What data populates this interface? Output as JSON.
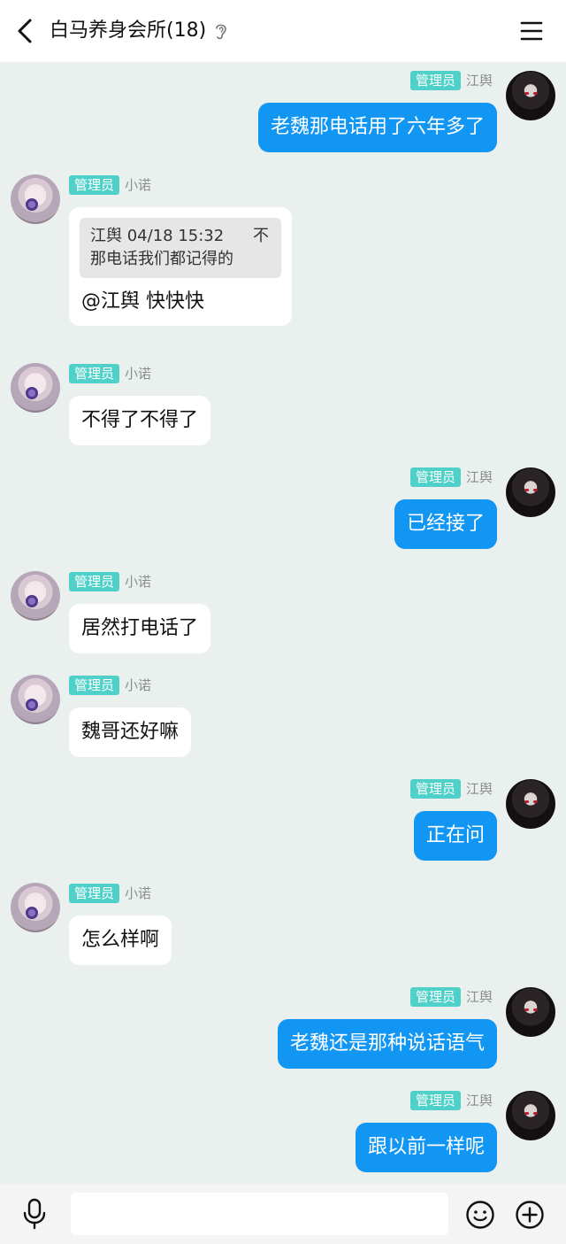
{
  "header": {
    "title": "白马养身会所(18)",
    "back_icon": "chevron-left-icon",
    "ear_icon": "ear-icon",
    "menu_icon": "hamburger-menu-icon"
  },
  "messages": [
    {
      "side": "right",
      "badge": "管理员",
      "nick": "江舆",
      "text": "老魏那电话用了六年多了"
    },
    {
      "side": "left",
      "badge": "管理员",
      "nick": "小诺",
      "quote": {
        "header": "江舆 04/18 15:32",
        "close": "不",
        "text": "那电话我们都记得的"
      },
      "text": "@江舆 快快快"
    },
    {
      "side": "left",
      "badge": "管理员",
      "nick": "小诺",
      "text": "不得了不得了"
    },
    {
      "side": "right",
      "badge": "管理员",
      "nick": "江舆",
      "text": "已经接了"
    },
    {
      "side": "left",
      "badge": "管理员",
      "nick": "小诺",
      "text": "居然打电话了"
    },
    {
      "side": "left",
      "badge": "管理员",
      "nick": "小诺",
      "text": "魏哥还好嘛"
    },
    {
      "side": "right",
      "badge": "管理员",
      "nick": "江舆",
      "text": "正在问"
    },
    {
      "side": "left",
      "badge": "管理员",
      "nick": "小诺",
      "text": "怎么样啊"
    },
    {
      "side": "right",
      "badge": "管理员",
      "nick": "江舆",
      "text": "老魏还是那种说话语气"
    },
    {
      "side": "right",
      "badge": "管理员",
      "nick": "江舆",
      "text": "跟以前一样呢"
    }
  ],
  "input_bar": {
    "voice_icon": "microphone-icon",
    "input_value": "",
    "emoji_icon": "emoji-icon",
    "more_icon": "plus-circle-icon"
  },
  "colors": {
    "background": "#eaf0ed",
    "badge": "#4fd0c9",
    "outgoing_bubble": "#1296f3",
    "incoming_bubble": "#ffffff"
  }
}
